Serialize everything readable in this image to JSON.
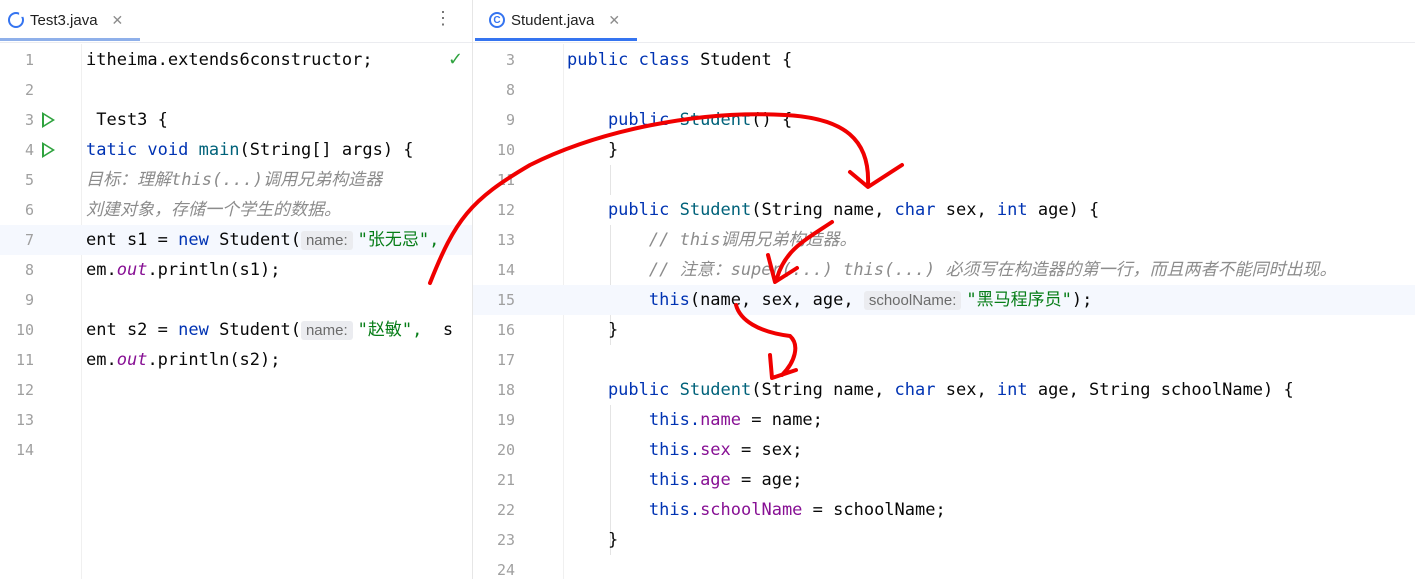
{
  "left": {
    "tab": {
      "name": "Test3.java"
    },
    "menu_icon": "more-vertical-icon",
    "lines": [
      {
        "n": "1",
        "segs": [
          {
            "t": "itheima.extends6constructor;",
            "c": "plain"
          }
        ],
        "check": true
      },
      {
        "n": "2",
        "segs": []
      },
      {
        "n": "3",
        "segs": [
          {
            "t": " Test3 {",
            "c": "plain"
          }
        ],
        "run": true
      },
      {
        "n": "4",
        "segs": [
          {
            "t": "tatic void ",
            "c": "kw"
          },
          {
            "t": "main",
            "c": "fn"
          },
          {
            "t": "(String[] args) {",
            "c": "plain"
          }
        ],
        "run": true
      },
      {
        "n": "5",
        "segs": [
          {
            "t": "目标：理解this(...)调用兄弟构造器",
            "c": "cm"
          }
        ]
      },
      {
        "n": "6",
        "segs": [
          {
            "t": "刘建对象，存储一个学生的数据。",
            "c": "cm"
          }
        ]
      },
      {
        "n": "7",
        "hl": true,
        "segs": [
          {
            "t": "ent s1 = ",
            "c": "plain"
          },
          {
            "t": "new ",
            "c": "kw"
          },
          {
            "t": "Student(",
            "c": "plain"
          },
          {
            "t": "name:",
            "c": "hint"
          },
          {
            "t": "\"张无忌\",",
            "c": "str"
          }
        ]
      },
      {
        "n": "8",
        "segs": [
          {
            "t": "em.",
            "c": "plain"
          },
          {
            "t": "out",
            "c": "it"
          },
          {
            "t": ".println(s1);",
            "c": "plain"
          }
        ]
      },
      {
        "n": "9",
        "segs": []
      },
      {
        "n": "10",
        "segs": [
          {
            "t": "ent s2 = ",
            "c": "plain"
          },
          {
            "t": "new ",
            "c": "kw"
          },
          {
            "t": "Student(",
            "c": "plain"
          },
          {
            "t": "name:",
            "c": "hint"
          },
          {
            "t": "\"赵敏\",",
            "c": "str"
          },
          {
            "t": "  s",
            "c": "plain"
          }
        ]
      },
      {
        "n": "11",
        "segs": [
          {
            "t": "em.",
            "c": "plain"
          },
          {
            "t": "out",
            "c": "it"
          },
          {
            "t": ".println(s2);",
            "c": "plain"
          }
        ]
      },
      {
        "n": "12",
        "segs": []
      },
      {
        "n": "13",
        "segs": []
      },
      {
        "n": "14",
        "segs": []
      }
    ]
  },
  "right": {
    "tab": {
      "name": "Student.java",
      "icon": "class-c-icon"
    },
    "lines": [
      {
        "n": "3",
        "segs": [
          {
            "t": "public class ",
            "c": "kw"
          },
          {
            "t": "Student {",
            "c": "plain"
          }
        ]
      },
      {
        "n": "8",
        "segs": []
      },
      {
        "n": "9",
        "segs": [
          {
            "t": "    public ",
            "c": "kw"
          },
          {
            "t": "Student",
            "c": "fn"
          },
          {
            "t": "() {",
            "c": "plain"
          }
        ]
      },
      {
        "n": "10",
        "segs": [
          {
            "t": "    }",
            "c": "plain"
          }
        ]
      },
      {
        "n": "11",
        "segs": []
      },
      {
        "n": "12",
        "segs": [
          {
            "t": "    public ",
            "c": "kw"
          },
          {
            "t": "Student",
            "c": "fn"
          },
          {
            "t": "(String name, ",
            "c": "plain"
          },
          {
            "t": "char ",
            "c": "kw"
          },
          {
            "t": "sex, ",
            "c": "plain"
          },
          {
            "t": "int ",
            "c": "kw"
          },
          {
            "t": "age) {",
            "c": "plain"
          }
        ]
      },
      {
        "n": "13",
        "segs": [
          {
            "t": "        // this调用兄弟构造器。",
            "c": "cm"
          }
        ]
      },
      {
        "n": "14",
        "segs": [
          {
            "t": "        // 注意：super(...) this(...) 必须写在构造器的第一行，而且两者不能同时出现。",
            "c": "cm"
          }
        ]
      },
      {
        "n": "15",
        "hl": true,
        "segs": [
          {
            "t": "        this",
            "c": "kw"
          },
          {
            "t": "(name, sex, age, ",
            "c": "plain"
          },
          {
            "t": "schoolName:",
            "c": "hint"
          },
          {
            "t": "\"黑马程序员\"",
            "c": "str"
          },
          {
            "t": ");",
            "c": "plain"
          }
        ]
      },
      {
        "n": "16",
        "segs": [
          {
            "t": "    }",
            "c": "plain"
          }
        ]
      },
      {
        "n": "17",
        "segs": []
      },
      {
        "n": "18",
        "segs": [
          {
            "t": "    public ",
            "c": "kw"
          },
          {
            "t": "Student",
            "c": "fn"
          },
          {
            "t": "(String name, ",
            "c": "plain"
          },
          {
            "t": "char ",
            "c": "kw"
          },
          {
            "t": "sex, ",
            "c": "plain"
          },
          {
            "t": "int ",
            "c": "kw"
          },
          {
            "t": "age, String schoolName) {",
            "c": "plain"
          }
        ]
      },
      {
        "n": "19",
        "segs": [
          {
            "t": "        this.",
            "c": "kw"
          },
          {
            "t": "name",
            "c": "fld"
          },
          {
            "t": " = name;",
            "c": "plain"
          }
        ]
      },
      {
        "n": "20",
        "segs": [
          {
            "t": "        this.",
            "c": "kw"
          },
          {
            "t": "sex",
            "c": "fld"
          },
          {
            "t": " = sex;",
            "c": "plain"
          }
        ]
      },
      {
        "n": "21",
        "segs": [
          {
            "t": "        this.",
            "c": "kw"
          },
          {
            "t": "age",
            "c": "fld"
          },
          {
            "t": " = age;",
            "c": "plain"
          }
        ]
      },
      {
        "n": "22",
        "segs": [
          {
            "t": "        this.",
            "c": "kw"
          },
          {
            "t": "schoolName",
            "c": "fld"
          },
          {
            "t": " = schoolName;",
            "c": "plain"
          }
        ]
      },
      {
        "n": "23",
        "segs": [
          {
            "t": "    }",
            "c": "plain"
          }
        ]
      },
      {
        "n": "24",
        "segs": []
      }
    ]
  },
  "colors": {
    "tab_underline_left": "#8fb0ea",
    "tab_underline_right": "#3574f0",
    "annotation": "#f00000",
    "run_icon": "#2fa33f"
  }
}
